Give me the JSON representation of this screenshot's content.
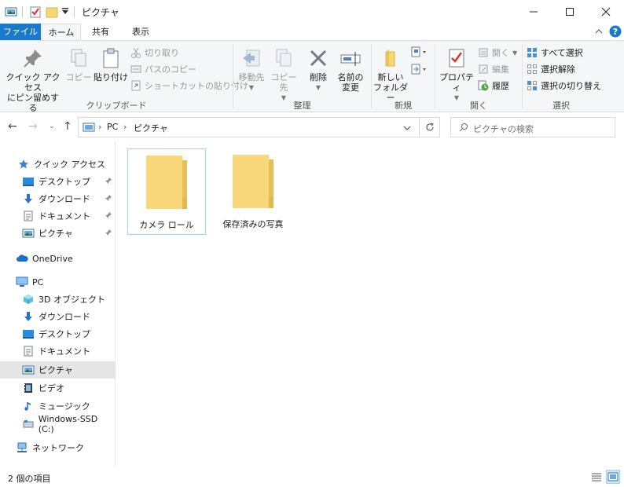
{
  "window": {
    "title": "ピクチャ",
    "controls": {
      "minimize": "—",
      "maximize": "☐",
      "close": "✕"
    }
  },
  "ribbon_tabs": [
    {
      "label": "ファイル",
      "active": false
    },
    {
      "label": "ホーム",
      "active": true
    },
    {
      "label": "共有",
      "active": false
    },
    {
      "label": "表示",
      "active": false
    }
  ],
  "ribbon_controls": {
    "expand": "⌃",
    "help": "?"
  },
  "ribbon": {
    "clipboard": {
      "label": "クリップボード",
      "pin": {
        "line1": "クイック アクセス",
        "line2": "にピン留めする"
      },
      "copy": "コピー",
      "paste": "貼り付け",
      "cut": "切り取り",
      "copy_path": "パスのコピー",
      "paste_shortcut": "ショートカットの貼り付け"
    },
    "organize": {
      "label": "整理",
      "move_to": "移動先",
      "copy_to": "コピー先",
      "delete": "削除",
      "rename": {
        "line1": "名前の",
        "line2": "変更"
      }
    },
    "new": {
      "label": "新規",
      "new_folder": {
        "line1": "新しい",
        "line2": "フォルダー"
      }
    },
    "open": {
      "label": "開く",
      "properties": "プロパティ",
      "open": "開く",
      "edit": "編集",
      "history": "履歴"
    },
    "select": {
      "label": "選択",
      "select_all": "すべて選択",
      "select_none": "選択解除",
      "invert": "選択の切り替え"
    }
  },
  "address": {
    "crumbs": [
      "PC",
      "ピクチャ"
    ],
    "search_placeholder": "ピクチャの検索"
  },
  "nav_pane": {
    "quick_access": {
      "label": "クイック アクセス",
      "items": [
        {
          "label": "デスクトップ",
          "icon": "desktop-icon",
          "pinned": true
        },
        {
          "label": "ダウンロード",
          "icon": "download-icon",
          "pinned": true
        },
        {
          "label": "ドキュメント",
          "icon": "document-icon",
          "pinned": true
        },
        {
          "label": "ピクチャ",
          "icon": "pictures-icon",
          "pinned": true
        }
      ]
    },
    "onedrive": "OneDrive",
    "pc": {
      "label": "PC",
      "items": [
        {
          "label": "3D オブジェクト",
          "icon": "3d-objects-icon"
        },
        {
          "label": "ダウンロード",
          "icon": "download-icon"
        },
        {
          "label": "デスクトップ",
          "icon": "desktop-icon"
        },
        {
          "label": "ドキュメント",
          "icon": "document-icon"
        },
        {
          "label": "ピクチャ",
          "icon": "pictures-icon",
          "selected": true
        },
        {
          "label": "ビデオ",
          "icon": "video-icon"
        },
        {
          "label": "ミュージック",
          "icon": "music-icon"
        },
        {
          "label": "Windows-SSD (C:)",
          "icon": "drive-icon"
        }
      ]
    },
    "network": "ネットワーク"
  },
  "content": {
    "items": [
      {
        "name": "カメラ ロール",
        "icon": "folder-icon",
        "selected": true
      },
      {
        "name": "保存済みの写真",
        "icon": "folder-icon",
        "selected": false
      }
    ]
  },
  "status": {
    "item_count": "2 個の項目"
  },
  "colors": {
    "file_tab": "#1979ca",
    "ribbon_bg": "#f5f6f7",
    "selection": "#cce8ff",
    "folder": "#f7d774"
  }
}
